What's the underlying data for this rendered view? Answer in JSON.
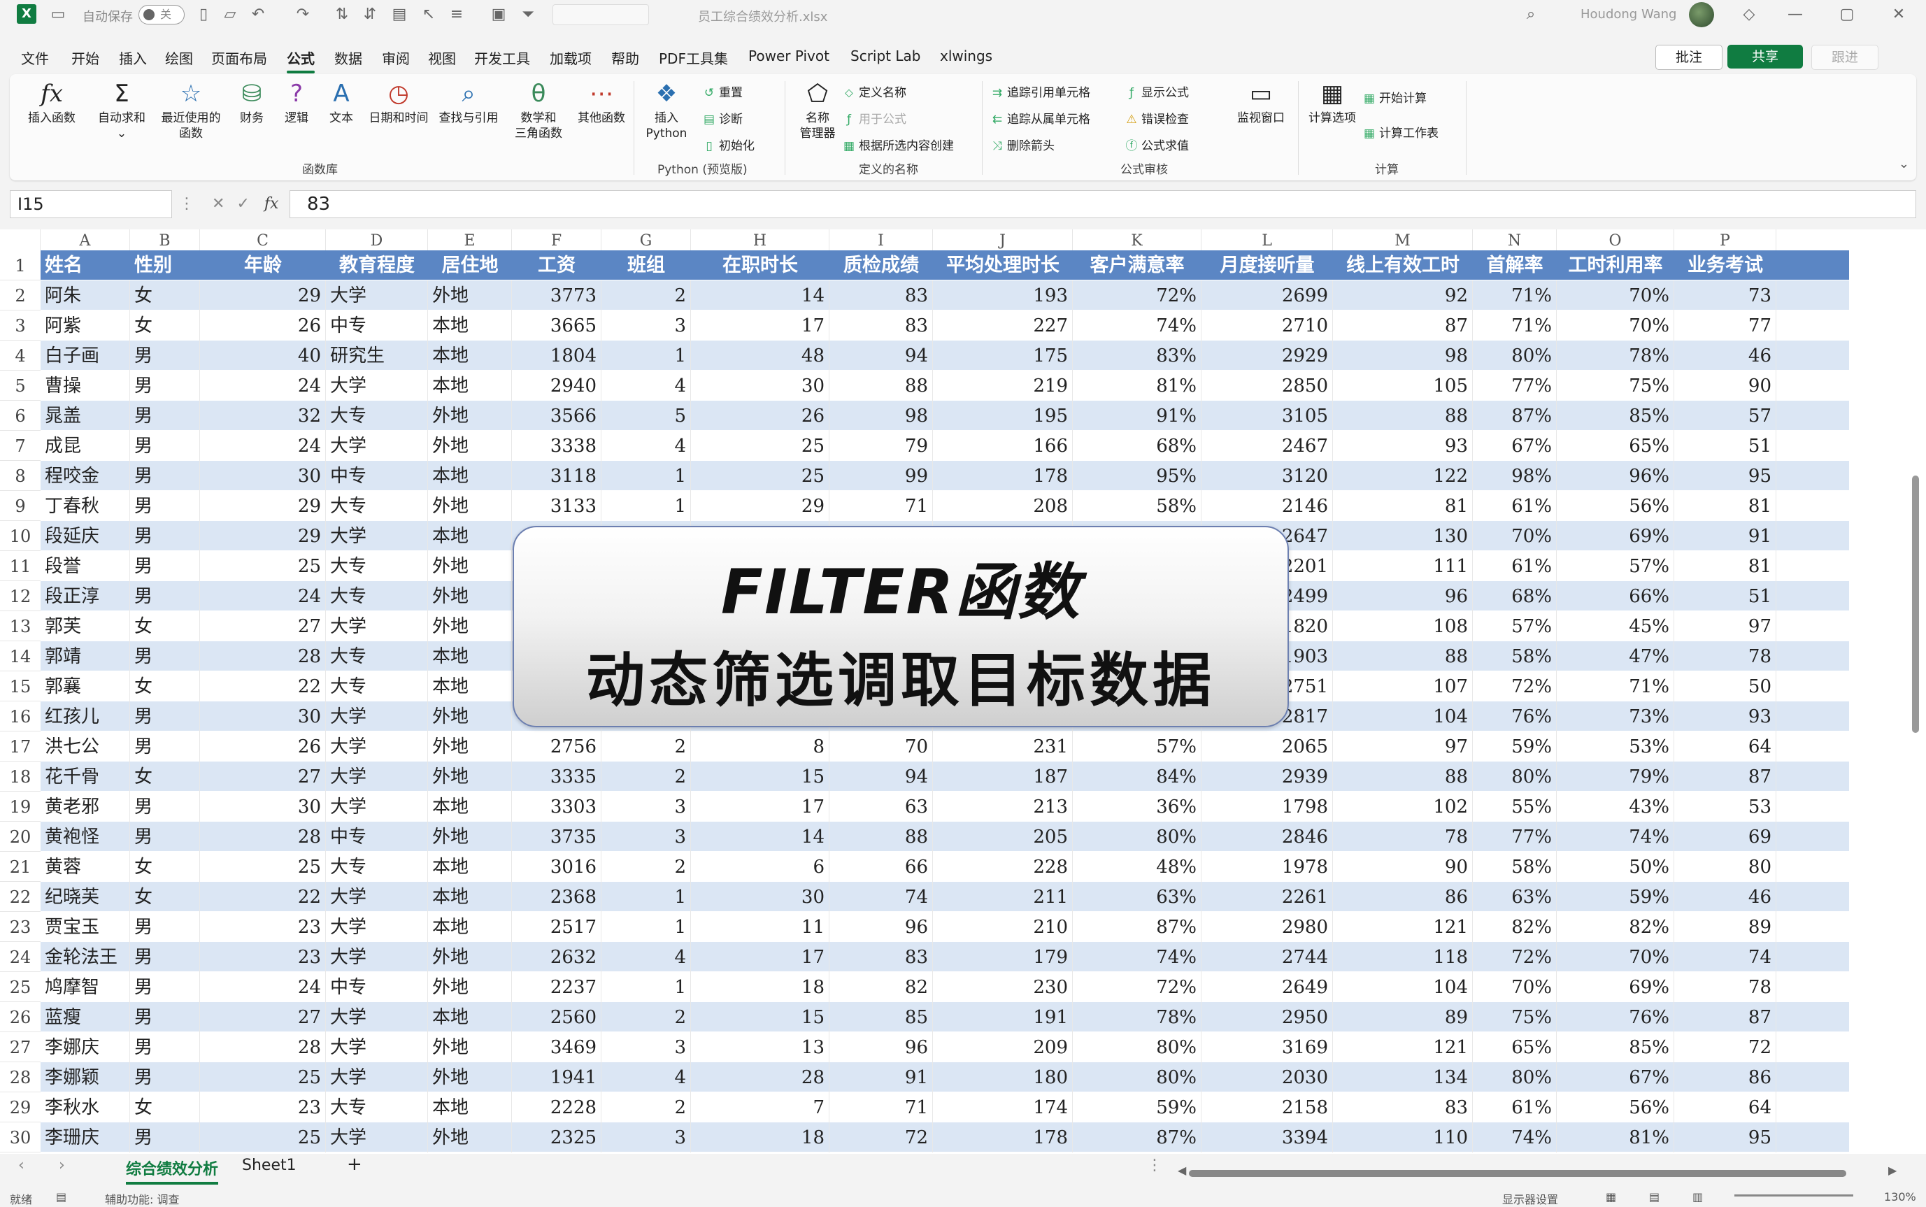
{
  "titlebar": {
    "autosave_label": "自动保存",
    "autosave_state": "关",
    "filename": "员工综合绩效分析.xlsx",
    "username": "Houdong Wang"
  },
  "menu": [
    "文件",
    "开始",
    "插入",
    "绘图",
    "页面布局",
    "公式",
    "数据",
    "审阅",
    "视图",
    "开发工具",
    "加载项",
    "帮助",
    "PDF工具集",
    "Power Pivot",
    "Script Lab",
    "xlwings"
  ],
  "menu_active": "公式",
  "actions": {
    "comment": "批注",
    "share": "共享",
    "catchup": "跟进"
  },
  "ribbon": {
    "insert_function": "插入函数",
    "autosum": "自动求和",
    "recent_line1": "最近使用的",
    "recent_line2": "函数",
    "financial": "财务",
    "logical": "逻辑",
    "text": "文本",
    "datetime": "日期和时间",
    "lookup": "查找与引用",
    "math_line1": "数学和",
    "math_line2": "三角函数",
    "more": "其他函数",
    "group_library": "函数库",
    "insert_python_line1": "插入",
    "insert_python_line2": "Python",
    "reset": "重置",
    "diagnose": "诊断",
    "initialize": "初始化",
    "group_python": "Python (预览版)",
    "name_manager_line1": "名称",
    "name_manager_line2": "管理器",
    "define_name": "定义名称",
    "use_in_formula": "用于公式",
    "create_from_sel": "根据所选内容创建",
    "group_names": "定义的名称",
    "trace_precedents": "追踪引用单元格",
    "trace_dependents": "追踪从属单元格",
    "remove_arrows": "删除箭头",
    "show_formulas": "显示公式",
    "error_check": "错误检查",
    "evaluate": "公式求值",
    "watch_window": "监视窗口",
    "group_audit": "公式审核",
    "calc_options": "计算选项",
    "calc_now": "开始计算",
    "calc_sheet": "计算工作表",
    "group_calc": "计算"
  },
  "formula_bar": {
    "name_box": "I15",
    "fx": "fx",
    "value": "83"
  },
  "columns": [
    "A",
    "B",
    "C",
    "D",
    "E",
    "F",
    "G",
    "H",
    "I",
    "J",
    "K",
    "L",
    "M",
    "N",
    "O",
    "P"
  ],
  "headers": [
    "姓名",
    "性别",
    "年龄",
    "教育程度",
    "居住地",
    "工资",
    "班组",
    "在职时长",
    "质检成绩",
    "平均处理时长",
    "客户满意率",
    "月度接听量",
    "线上有效工时",
    "首解率",
    "工时利用率",
    "业务考试"
  ],
  "rows": [
    [
      "阿朱",
      "女",
      "29",
      "大学",
      "外地",
      "3773",
      "2",
      "14",
      "83",
      "193",
      "72%",
      "2699",
      "92",
      "71%",
      "70%",
      "73"
    ],
    [
      "阿紫",
      "女",
      "26",
      "中专",
      "本地",
      "3665",
      "3",
      "17",
      "83",
      "227",
      "74%",
      "2710",
      "87",
      "71%",
      "70%",
      "77"
    ],
    [
      "白子画",
      "男",
      "40",
      "研究生",
      "本地",
      "1804",
      "1",
      "48",
      "94",
      "175",
      "83%",
      "2929",
      "98",
      "80%",
      "78%",
      "46"
    ],
    [
      "曹操",
      "男",
      "24",
      "大学",
      "本地",
      "2940",
      "4",
      "30",
      "88",
      "219",
      "81%",
      "2850",
      "105",
      "77%",
      "75%",
      "90"
    ],
    [
      "晁盖",
      "男",
      "32",
      "大专",
      "外地",
      "3566",
      "5",
      "26",
      "98",
      "195",
      "91%",
      "3105",
      "88",
      "87%",
      "85%",
      "57"
    ],
    [
      "成昆",
      "男",
      "24",
      "大学",
      "外地",
      "3338",
      "4",
      "25",
      "79",
      "166",
      "68%",
      "2467",
      "93",
      "67%",
      "65%",
      "51"
    ],
    [
      "程咬金",
      "男",
      "30",
      "中专",
      "本地",
      "3118",
      "1",
      "25",
      "99",
      "178",
      "95%",
      "3120",
      "122",
      "98%",
      "96%",
      "95"
    ],
    [
      "丁春秋",
      "男",
      "29",
      "大专",
      "外地",
      "3133",
      "1",
      "29",
      "71",
      "208",
      "58%",
      "2146",
      "81",
      "61%",
      "56%",
      "81"
    ],
    [
      "段延庆",
      "男",
      "29",
      "大学",
      "本地",
      "",
      "",
      "",
      "",
      "",
      "",
      "2647",
      "130",
      "70%",
      "69%",
      "91"
    ],
    [
      "段誉",
      "男",
      "25",
      "大专",
      "外地",
      "",
      "",
      "",
      "",
      "",
      "",
      "2201",
      "111",
      "61%",
      "57%",
      "81"
    ],
    [
      "段正淳",
      "男",
      "24",
      "大专",
      "外地",
      "",
      "",
      "",
      "",
      "",
      "",
      "2499",
      "96",
      "68%",
      "66%",
      "51"
    ],
    [
      "郭芙",
      "女",
      "27",
      "大学",
      "外地",
      "",
      "",
      "",
      "",
      "",
      "",
      "1820",
      "108",
      "57%",
      "45%",
      "97"
    ],
    [
      "郭靖",
      "男",
      "28",
      "大专",
      "本地",
      "",
      "",
      "",
      "",
      "",
      "",
      "1903",
      "88",
      "58%",
      "47%",
      "78"
    ],
    [
      "郭襄",
      "女",
      "22",
      "大专",
      "本地",
      "",
      "",
      "",
      "",
      "",
      "",
      "2751",
      "107",
      "72%",
      "71%",
      "50"
    ],
    [
      "红孩儿",
      "男",
      "30",
      "大学",
      "外地",
      "",
      "",
      "",
      "",
      "",
      "",
      "2817",
      "104",
      "76%",
      "73%",
      "93"
    ],
    [
      "洪七公",
      "男",
      "26",
      "大学",
      "外地",
      "2756",
      "2",
      "8",
      "70",
      "231",
      "57%",
      "2065",
      "97",
      "59%",
      "53%",
      "64"
    ],
    [
      "花千骨",
      "女",
      "27",
      "大学",
      "外地",
      "3335",
      "2",
      "15",
      "94",
      "187",
      "84%",
      "2939",
      "88",
      "80%",
      "79%",
      "87"
    ],
    [
      "黄老邪",
      "男",
      "30",
      "大学",
      "本地",
      "3303",
      "3",
      "17",
      "63",
      "213",
      "36%",
      "1798",
      "102",
      "55%",
      "43%",
      "53"
    ],
    [
      "黄袍怪",
      "男",
      "28",
      "中专",
      "外地",
      "3735",
      "3",
      "14",
      "88",
      "205",
      "80%",
      "2846",
      "78",
      "77%",
      "74%",
      "69"
    ],
    [
      "黄蓉",
      "女",
      "25",
      "大专",
      "本地",
      "3016",
      "2",
      "6",
      "66",
      "228",
      "48%",
      "1978",
      "90",
      "58%",
      "50%",
      "80"
    ],
    [
      "纪晓芙",
      "女",
      "22",
      "大学",
      "本地",
      "2368",
      "1",
      "30",
      "74",
      "211",
      "63%",
      "2261",
      "86",
      "63%",
      "59%",
      "46"
    ],
    [
      "贾宝玉",
      "男",
      "23",
      "大学",
      "本地",
      "2517",
      "1",
      "11",
      "96",
      "210",
      "87%",
      "2980",
      "121",
      "82%",
      "82%",
      "89"
    ],
    [
      "金轮法王",
      "男",
      "23",
      "大学",
      "外地",
      "2632",
      "4",
      "17",
      "83",
      "179",
      "74%",
      "2744",
      "118",
      "72%",
      "70%",
      "74"
    ],
    [
      "鸠摩智",
      "男",
      "24",
      "中专",
      "外地",
      "2237",
      "1",
      "18",
      "82",
      "230",
      "72%",
      "2649",
      "104",
      "70%",
      "69%",
      "78"
    ],
    [
      "蓝瘦",
      "男",
      "27",
      "大学",
      "本地",
      "2560",
      "2",
      "15",
      "85",
      "191",
      "78%",
      "2950",
      "89",
      "75%",
      "76%",
      "87"
    ],
    [
      "李娜庆",
      "男",
      "28",
      "大学",
      "外地",
      "3469",
      "3",
      "13",
      "96",
      "209",
      "80%",
      "3169",
      "121",
      "65%",
      "85%",
      "72"
    ],
    [
      "李娜颖",
      "男",
      "25",
      "大学",
      "外地",
      "1941",
      "4",
      "28",
      "91",
      "180",
      "80%",
      "2030",
      "134",
      "80%",
      "67%",
      "86"
    ],
    [
      "李秋水",
      "女",
      "23",
      "大专",
      "本地",
      "2228",
      "2",
      "7",
      "71",
      "174",
      "59%",
      "2158",
      "83",
      "61%",
      "56%",
      "64"
    ],
    [
      "李珊庆",
      "男",
      "25",
      "大学",
      "外地",
      "2325",
      "3",
      "18",
      "72",
      "178",
      "87%",
      "3394",
      "110",
      "74%",
      "81%",
      "95"
    ]
  ],
  "banner": {
    "line1": "FILTER函数",
    "line2": "动态筛选调取目标数据"
  },
  "sheet_tabs": [
    "综合绩效分析",
    "Sheet1"
  ],
  "sheet_tab_active": "综合绩效分析",
  "status": {
    "ready": "就绪",
    "accessibility": "辅助功能: 调查",
    "display_settings": "显示器设置",
    "zoom": "130%"
  }
}
